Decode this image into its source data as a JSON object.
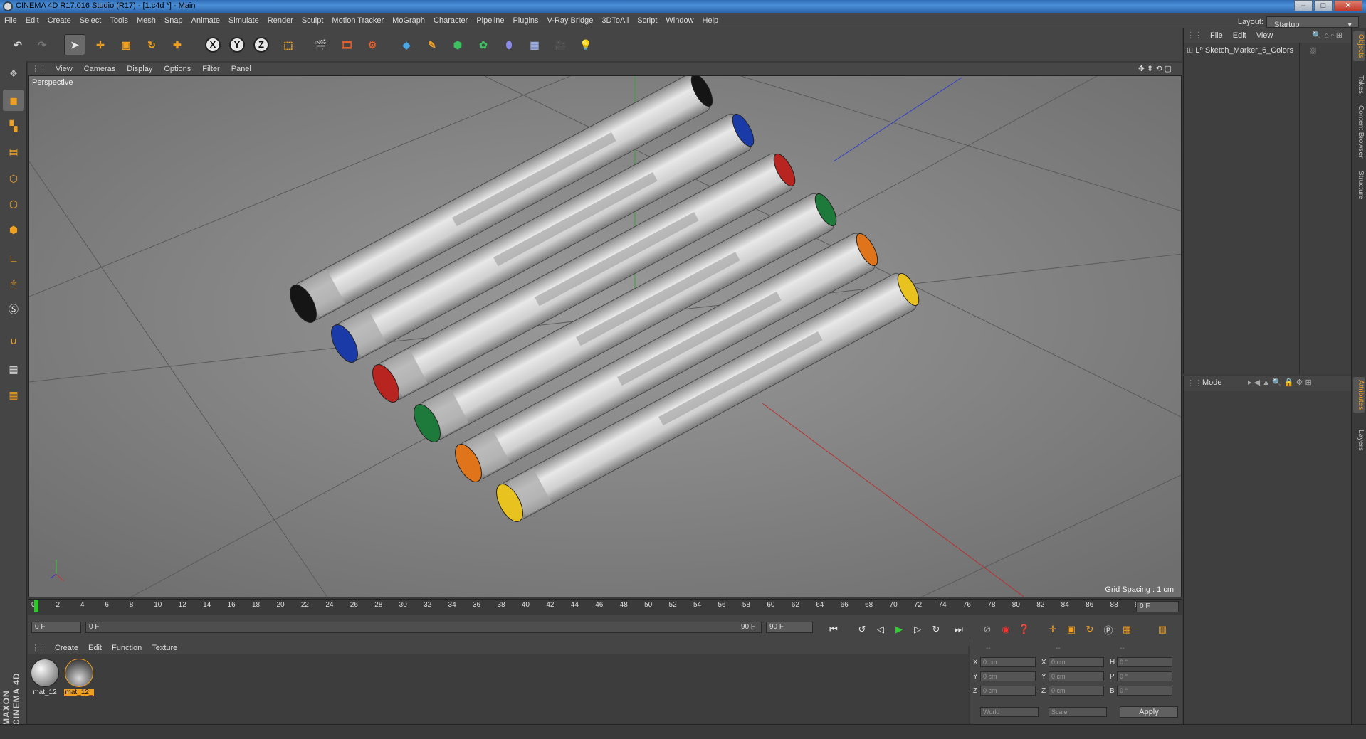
{
  "window": {
    "title": "CINEMA 4D R17.016 Studio (R17) - [1.c4d *] - Main",
    "min": "–",
    "max": "□",
    "close": "✕"
  },
  "menu": {
    "items": [
      "File",
      "Edit",
      "Create",
      "Select",
      "Tools",
      "Mesh",
      "Snap",
      "Animate",
      "Simulate",
      "Render",
      "Sculpt",
      "Motion Tracker",
      "MoGraph",
      "Character",
      "Pipeline",
      "Plugins",
      "V-Ray Bridge",
      "3DToAll",
      "Script",
      "Window",
      "Help"
    ],
    "layout_label": "Layout:",
    "layout_value": "Startup"
  },
  "toolbar": {
    "x": "X",
    "y": "Y",
    "z": "Z"
  },
  "viewport": {
    "menu": [
      "View",
      "Cameras",
      "Display",
      "Options",
      "Filter",
      "Panel"
    ],
    "label": "Perspective",
    "grid_spacing": "Grid Spacing : 1 cm",
    "marker_caps": [
      "#151515",
      "#1a3aa8",
      "#b82520",
      "#1d7a3a",
      "#e0741b",
      "#e8c21e"
    ]
  },
  "timeline": {
    "ticks": [
      "0",
      "2",
      "4",
      "6",
      "8",
      "10",
      "12",
      "14",
      "16",
      "18",
      "20",
      "22",
      "24",
      "26",
      "28",
      "30",
      "32",
      "34",
      "36",
      "38",
      "40",
      "42",
      "44",
      "46",
      "48",
      "50",
      "52",
      "54",
      "56",
      "58",
      "60",
      "62",
      "64",
      "66",
      "68",
      "70",
      "72",
      "74",
      "76",
      "78",
      "80",
      "82",
      "84",
      "86",
      "88",
      "90"
    ],
    "end_frame": "0 F"
  },
  "playbar": {
    "start": "0 F",
    "slider_start": "0 F",
    "slider_end": "90 F",
    "end": "90 F"
  },
  "materials": {
    "menu": [
      "Create",
      "Edit",
      "Function",
      "Texture"
    ],
    "items": [
      {
        "label": "mat_12"
      },
      {
        "label": "mat_12_"
      }
    ]
  },
  "coords": {
    "header": [
      "--",
      "--",
      "--"
    ],
    "rows": [
      {
        "a": "X",
        "av": "0 cm",
        "b": "X",
        "bv": "0 cm",
        "c": "H",
        "cv": "0 °"
      },
      {
        "a": "Y",
        "av": "0 cm",
        "b": "Y",
        "bv": "0 cm",
        "c": "P",
        "cv": "0 °"
      },
      {
        "a": "Z",
        "av": "0 cm",
        "b": "Z",
        "bv": "0 cm",
        "c": "B",
        "cv": "0 °"
      }
    ],
    "mode1": "World",
    "mode2": "Scale",
    "apply": "Apply"
  },
  "objects": {
    "menu": [
      "File",
      "Edit",
      "View"
    ],
    "item": "Sketch_Marker_6_Colors"
  },
  "attributes": {
    "mode": "Mode"
  },
  "side_tabs": [
    "Objects",
    "Takes",
    "Content Browser",
    "Structure",
    "Attributes",
    "Layers"
  ],
  "brand": "MAXON CINEMA 4D"
}
